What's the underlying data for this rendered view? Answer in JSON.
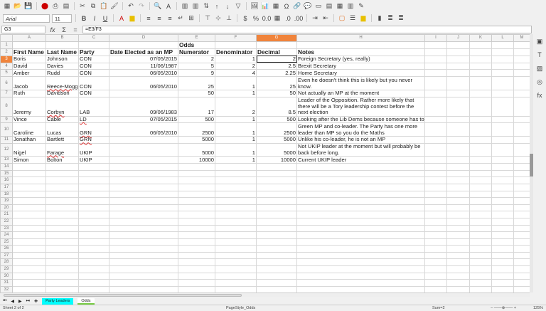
{
  "toolbar": {
    "font_name": "Arial",
    "font_size": "11"
  },
  "formula_bar": {
    "cell_ref": "G3",
    "formula": "=E3/F3",
    "func_symbol": "Σ",
    "eq_symbol": "="
  },
  "columns": [
    "A",
    "B",
    "C",
    "D",
    "E",
    "F",
    "G",
    "H",
    "I",
    "J",
    "K",
    "L",
    "M"
  ],
  "selected_column": "G",
  "rows": [
    [
      "",
      "",
      "",
      "",
      "Odds",
      "",
      "",
      ""
    ],
    [
      "First Name",
      "Last Name",
      "Party",
      "Date Elected as an MP",
      "Numerator",
      "Denominator",
      "Decimal",
      "Notes"
    ],
    [
      "Boris",
      "Johnson",
      "CON",
      "07/05/2015",
      "2",
      "1",
      "2",
      "Foreign Secretary (yes, really)"
    ],
    [
      "David",
      "Davies",
      "CON",
      "11/06/1987",
      "5",
      "2",
      "2.5",
      "Brexit Secretary"
    ],
    [
      "Amber",
      "Rudd",
      "CON",
      "06/05/2010",
      "9",
      "4",
      "2.25",
      "Home Secretary"
    ],
    [
      "Jacob",
      "Reece-Mogg",
      "CON",
      "06/05/2010",
      "25",
      "1",
      "25",
      "Even he doesn't think this is likely but you never know."
    ],
    [
      "Ruth",
      "Davidson",
      "CON",
      "",
      "50",
      "1",
      "50",
      "Not actually an MP at the moment"
    ],
    [
      "Jeremy",
      "Corbyn",
      "LAB",
      "09/06/1983",
      "17",
      "2",
      "8.5",
      "Leader of the Opposition. Rather more likely that there will be a Tory leadership contest before the next election"
    ],
    [
      "Vince",
      "Cable",
      "LD",
      "07/05/2015",
      "500",
      "1",
      "500",
      "Looking after the Lib Dems because someone has to"
    ],
    [
      "Caroline",
      "Lucas",
      "GRN",
      "06/05/2010",
      "2500",
      "1",
      "2500",
      "Green MP and co-leader. The Party has one more leader than MP so you do the Maths"
    ],
    [
      "Jonathan",
      "Bartlett",
      "GRN",
      "",
      "5000",
      "1",
      "5000",
      "Unlike his co-leader, he is not an MP"
    ],
    [
      "Nigel",
      "Farage",
      "UKIP",
      "",
      "5000",
      "1",
      "5000",
      "Not UKIP leader at the moment but will probably be back before long."
    ],
    [
      "Simon",
      "Bolton",
      "UKIP",
      "",
      "10000",
      "1",
      "10000",
      "Current UKIP leader"
    ]
  ],
  "total_rows": 35,
  "sheet_tabs": [
    {
      "label": "Party Leaders",
      "color": "#00ffff"
    },
    {
      "label": "Odds",
      "active": true
    }
  ],
  "status": {
    "sheet": "Sheet 2 of 2",
    "page_style": "PageStyle_Odds",
    "sum": "Sum=2",
    "zoom": "125%"
  }
}
